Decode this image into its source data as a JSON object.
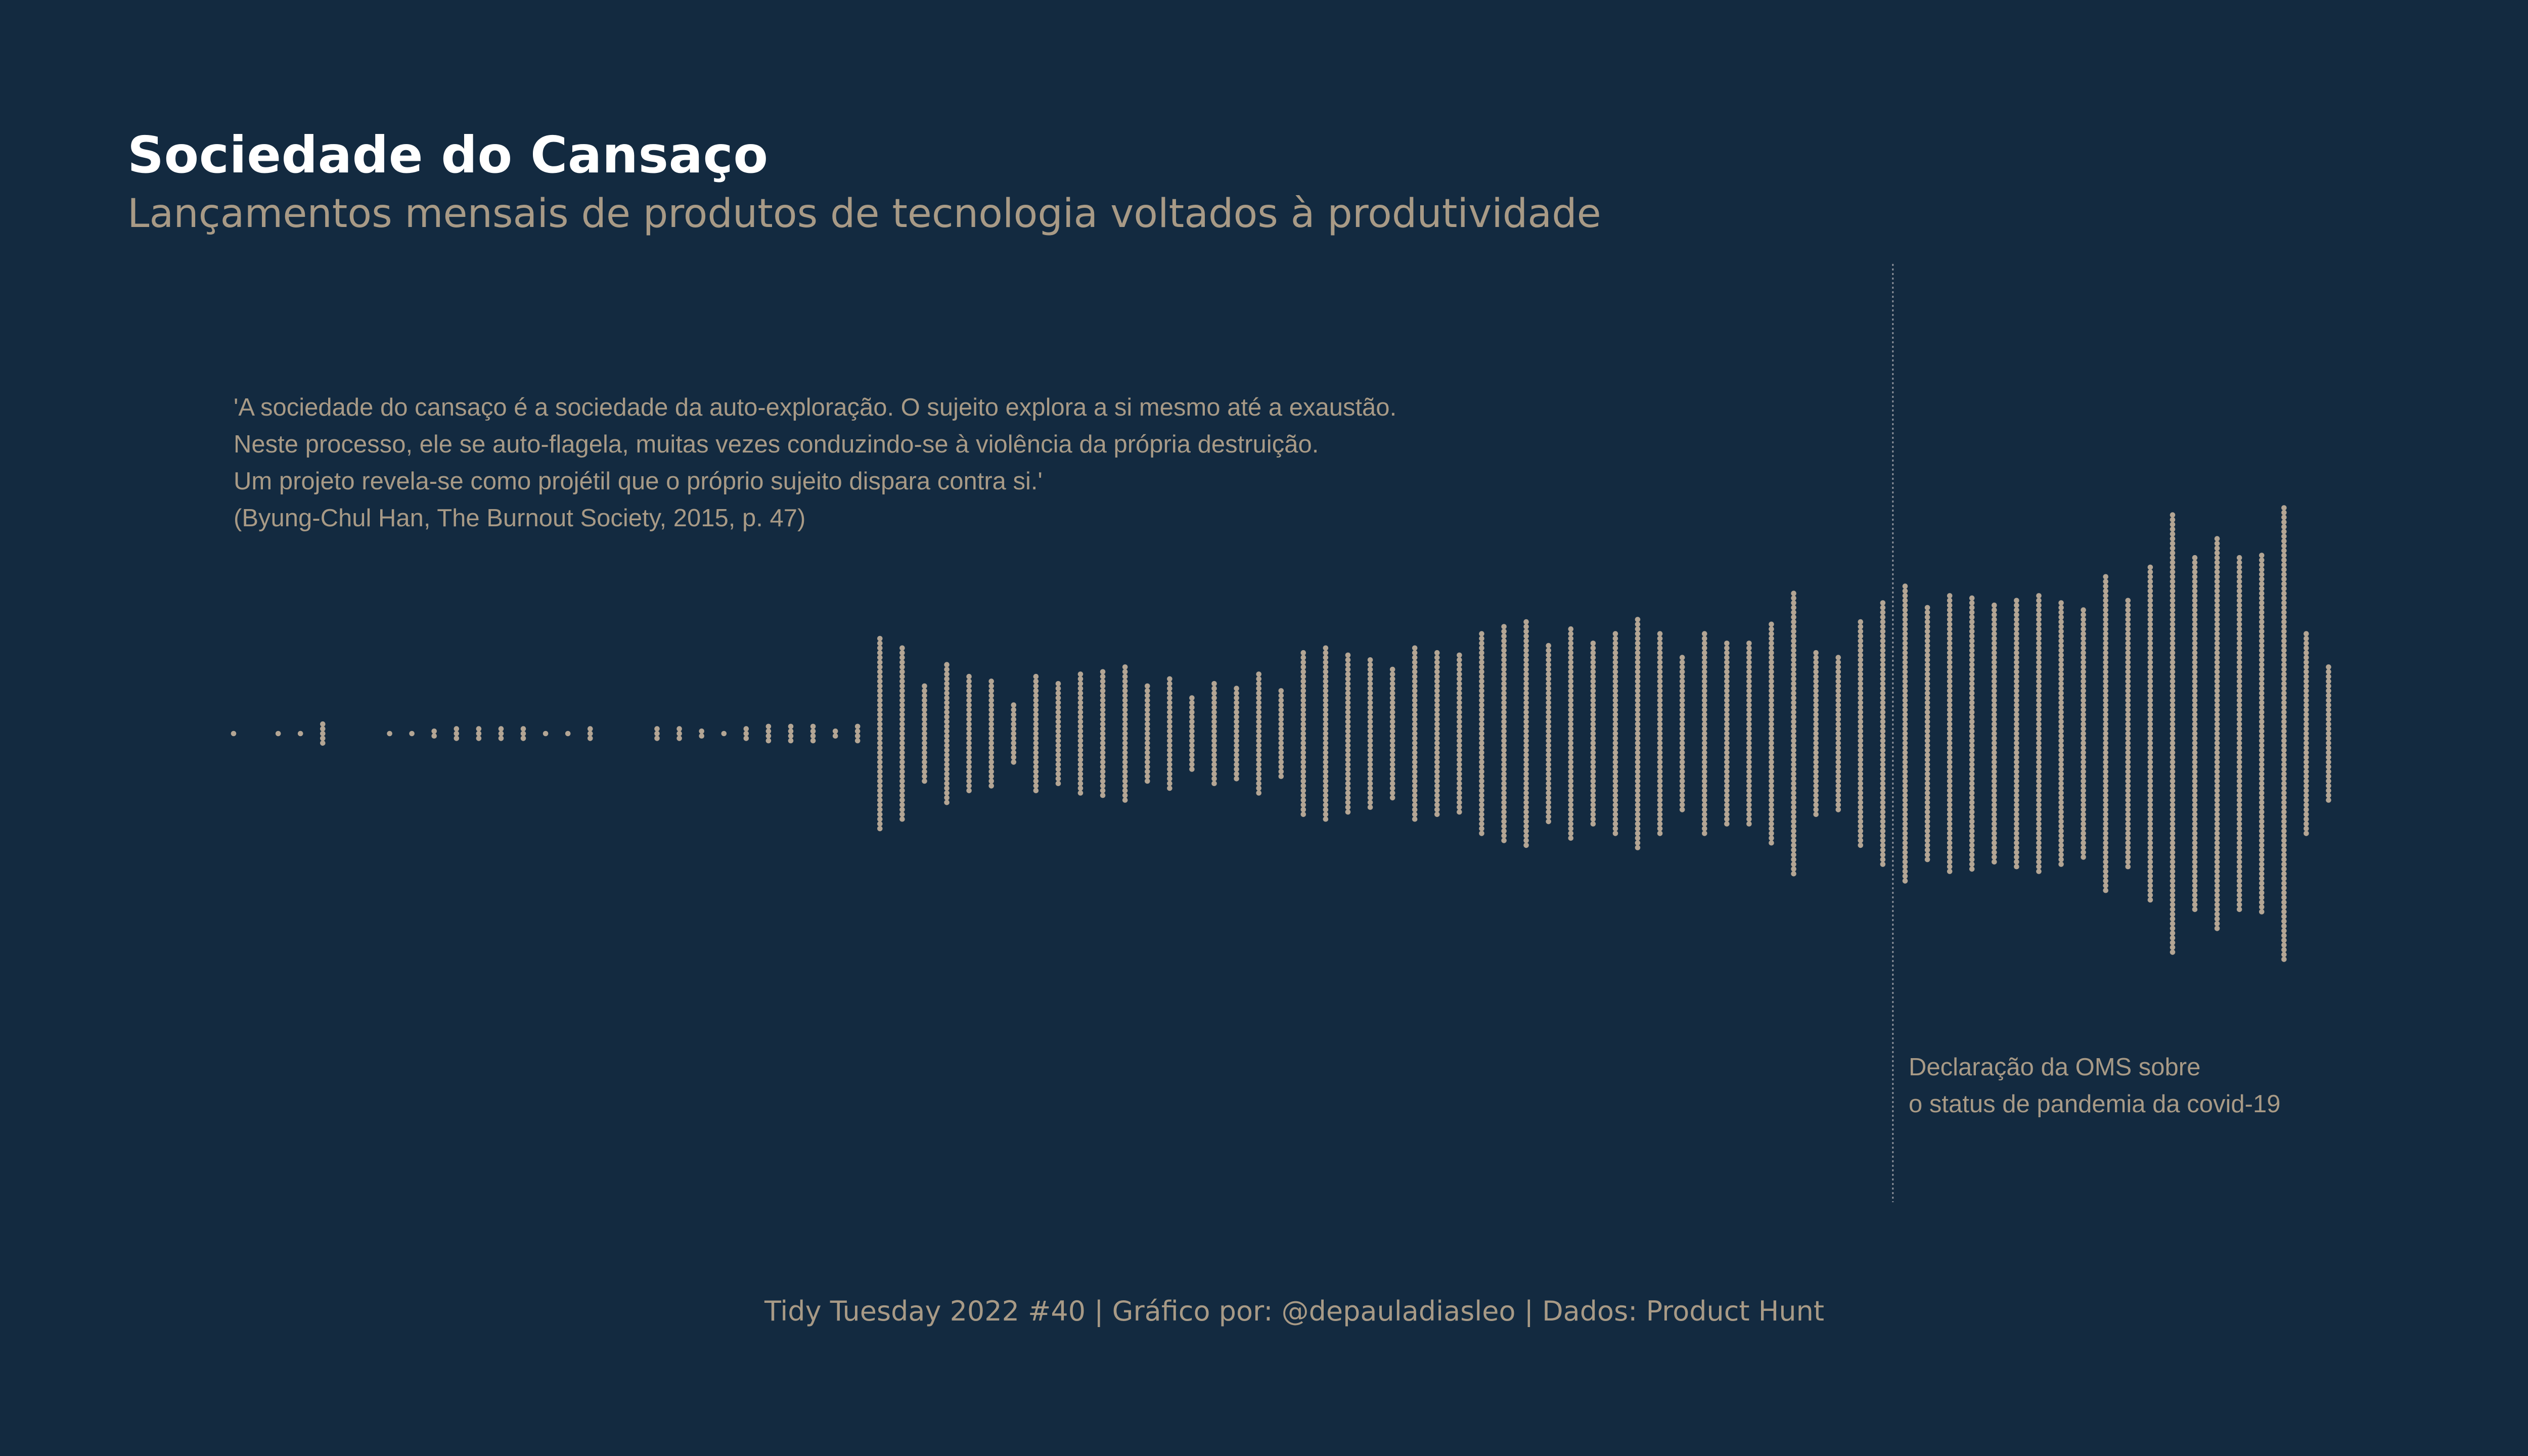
{
  "title": "Sociedade do Cansaço",
  "subtitle": "Lançamentos mensais de produtos de tecnologia voltados à produtividade",
  "quote_lines": [
    "'A sociedade do cansaço é a sociedade da auto-exploração. O sujeito explora a si mesmo até a exaustão.",
    "Neste processo, ele se auto-flagela, muitas vezes conduzindo-se à violência da própria destruição.",
    "Um projeto revela-se como projétil que o próprio sujeito dispara contra si.'",
    "(Byung-Chul Han, The Burnout Society, 2015, p. 47)"
  ],
  "annotation_lines": [
    "Declaração da OMS sobre",
    "o status de pandemia da covid-19"
  ],
  "caption": "Tidy Tuesday 2022 #40 | Gráfico por: @depauladiasleo | Dados: Product Hunt",
  "colors": {
    "background": "#132a40",
    "dots": "#b3a594",
    "annotation_line": "#8a8f99",
    "title": "#ffffff",
    "text": "#a89a86"
  },
  "chart_data": {
    "type": "scatter",
    "encoding": "stacked dots per month, symmetric around a horizontal center line",
    "x_start_month": "2014-01",
    "month_index": [
      0,
      2,
      3,
      4,
      7,
      8,
      9,
      10,
      11,
      12,
      13,
      14,
      15,
      16,
      19,
      20,
      21,
      22,
      23,
      24,
      25,
      26,
      27,
      28,
      29,
      30,
      31,
      32,
      33,
      34,
      35,
      36,
      37,
      38,
      39,
      40,
      41,
      42,
      43,
      44,
      45,
      46,
      47,
      48,
      49,
      50,
      51,
      52,
      53,
      54,
      55,
      56,
      57,
      58,
      59,
      60,
      61,
      62,
      63,
      64,
      65,
      66,
      67,
      68,
      69,
      70,
      71,
      72,
      73,
      74,
      75,
      76,
      77,
      78,
      79,
      80,
      81,
      82,
      83,
      84,
      85,
      86,
      87,
      88,
      89,
      90,
      91,
      92,
      93,
      94
    ],
    "counts": [
      1,
      1,
      1,
      5,
      1,
      1,
      2,
      3,
      3,
      3,
      3,
      1,
      1,
      3,
      3,
      3,
      2,
      1,
      3,
      4,
      4,
      4,
      2,
      4,
      41,
      37,
      21,
      30,
      25,
      23,
      13,
      25,
      22,
      26,
      27,
      29,
      21,
      24,
      16,
      22,
      20,
      26,
      19,
      35,
      37,
      34,
      32,
      28,
      37,
      35,
      34,
      43,
      46,
      48,
      38,
      45,
      39,
      43,
      49,
      43,
      33,
      43,
      39,
      39,
      47,
      60,
      35,
      33,
      48,
      56,
      63,
      54,
      59,
      58,
      55,
      57,
      59,
      56,
      53,
      67,
      57,
      71,
      93,
      75,
      83,
      75,
      76,
      96,
      43,
      29
    ],
    "annotation_month_index": 74,
    "grid": false,
    "legend": "none"
  }
}
